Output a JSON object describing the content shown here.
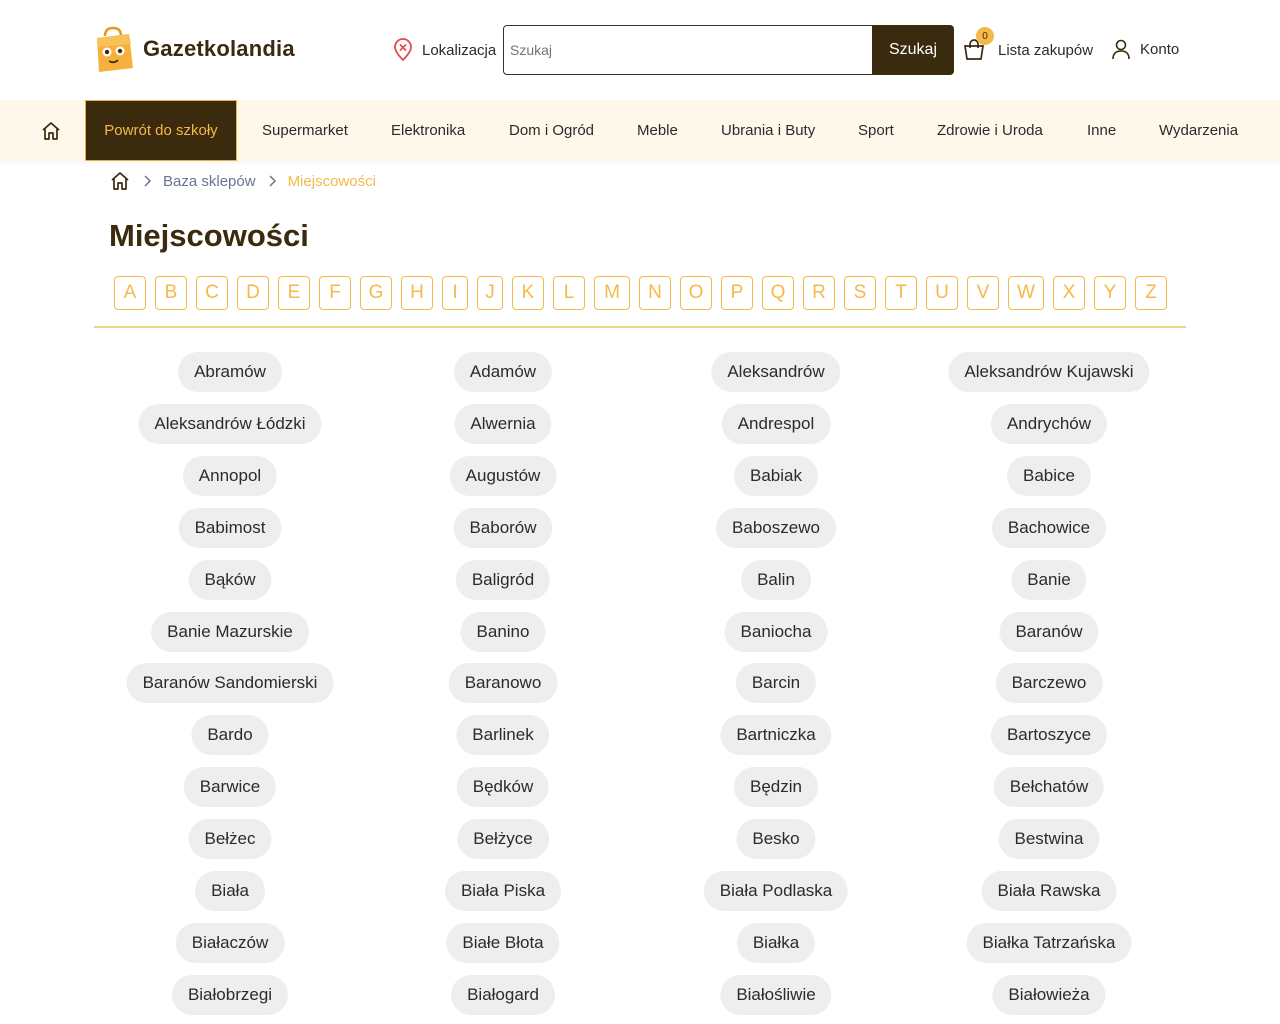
{
  "header": {
    "logo_text": "Gazetkolandia",
    "location_label": "Lokalizacja",
    "search_placeholder": "Szukaj",
    "search_button": "Szukaj",
    "cart_count": "0",
    "cart_label": "Lista zakupów",
    "account_label": "Konto"
  },
  "nav": {
    "items": [
      "Powrót do szkoły",
      "Supermarket",
      "Elektronika",
      "Dom i Ogród",
      "Meble",
      "Ubrania i Buty",
      "Sport",
      "Zdrowie i Uroda",
      "Inne",
      "Wydarzenia"
    ],
    "active_index": 0
  },
  "breadcrumb": {
    "items": [
      "Baza sklepów",
      "Miejscowości"
    ]
  },
  "page_title": "Miejscowości",
  "letters": [
    "A",
    "B",
    "C",
    "D",
    "E",
    "F",
    "G",
    "H",
    "I",
    "J",
    "K",
    "L",
    "M",
    "N",
    "O",
    "P",
    "Q",
    "R",
    "S",
    "T",
    "U",
    "V",
    "W",
    "X",
    "Y",
    "Z"
  ],
  "cities": [
    [
      "Abramów",
      "Adamów",
      "Aleksandrów",
      "Aleksandrów Kujawski"
    ],
    [
      "Aleksandrów Łódzki",
      "Alwernia",
      "Andrespol",
      "Andrychów"
    ],
    [
      "Annopol",
      "Augustów",
      "Babiak",
      "Babice"
    ],
    [
      "Babimost",
      "Baborów",
      "Baboszewo",
      "Bachowice"
    ],
    [
      "Bąków",
      "Baligród",
      "Balin",
      "Banie"
    ],
    [
      "Banie Mazurskie",
      "Banino",
      "Baniocha",
      "Baranów"
    ],
    [
      "Baranów Sandomierski",
      "Baranowo",
      "Barcin",
      "Barczewo"
    ],
    [
      "Bardo",
      "Barlinek",
      "Bartniczka",
      "Bartoszyce"
    ],
    [
      "Barwice",
      "Będków",
      "Będzin",
      "Bełchatów"
    ],
    [
      "Bełżec",
      "Bełżyce",
      "Besko",
      "Bestwina"
    ],
    [
      "Biała",
      "Biała Piska",
      "Biała Podlaska",
      "Biała Rawska"
    ],
    [
      "Białaczów",
      "Białe Błota",
      "Białka",
      "Białka Tatrzańska"
    ],
    [
      "Białobrzegi",
      "Białogard",
      "Białośliwie",
      "Białowieża"
    ]
  ],
  "colors": {
    "brand_dark": "#3a2a0e",
    "accent": "#f5b94a",
    "nav_bg": "#fef8eb",
    "pill_bg": "#eeeeee"
  }
}
